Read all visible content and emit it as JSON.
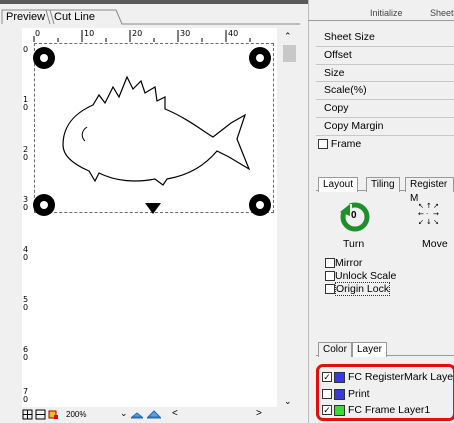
{
  "left_tabs": {
    "preview": "Preview",
    "cutline": "Cut Line"
  },
  "ruler": {
    "top": [
      "0",
      "10",
      "20",
      "30",
      "40"
    ],
    "left": [
      "0",
      "1\n0",
      "2\n0",
      "3\n0",
      "4\n0",
      "5\n0",
      "6\n0",
      "7\n0"
    ]
  },
  "zoom": "200%",
  "right_header": {
    "initialize": "Initialize",
    "sheet": "Sheet"
  },
  "sheet_menu": [
    "Sheet Size",
    "Offset",
    "Size",
    "Scale(%)",
    "Copy",
    "Copy Margin"
  ],
  "frame_label": "Frame",
  "tool_tabs": [
    "Layout",
    "Tiling",
    "Register M"
  ],
  "tool_buttons": {
    "turn_value": "0",
    "turn": "Turn",
    "move": "Move"
  },
  "options": [
    {
      "label": "Mirror",
      "checked": false
    },
    {
      "label": "Unlock Scale",
      "checked": false
    },
    {
      "label": "Origin Lock",
      "checked": false
    }
  ],
  "layer_tabs": [
    "Color",
    "Layer"
  ],
  "layers": [
    {
      "label": "FC RegisterMark Laye",
      "checked": true,
      "color": "#3a3ad8"
    },
    {
      "label": "Print",
      "checked": false,
      "color": "#3a3ad8"
    },
    {
      "label": "FC Frame Layer1",
      "checked": true,
      "color": "#33dd33"
    }
  ],
  "colors": {
    "turn_green": "#1e8f2a",
    "highlight": "#e01010"
  }
}
